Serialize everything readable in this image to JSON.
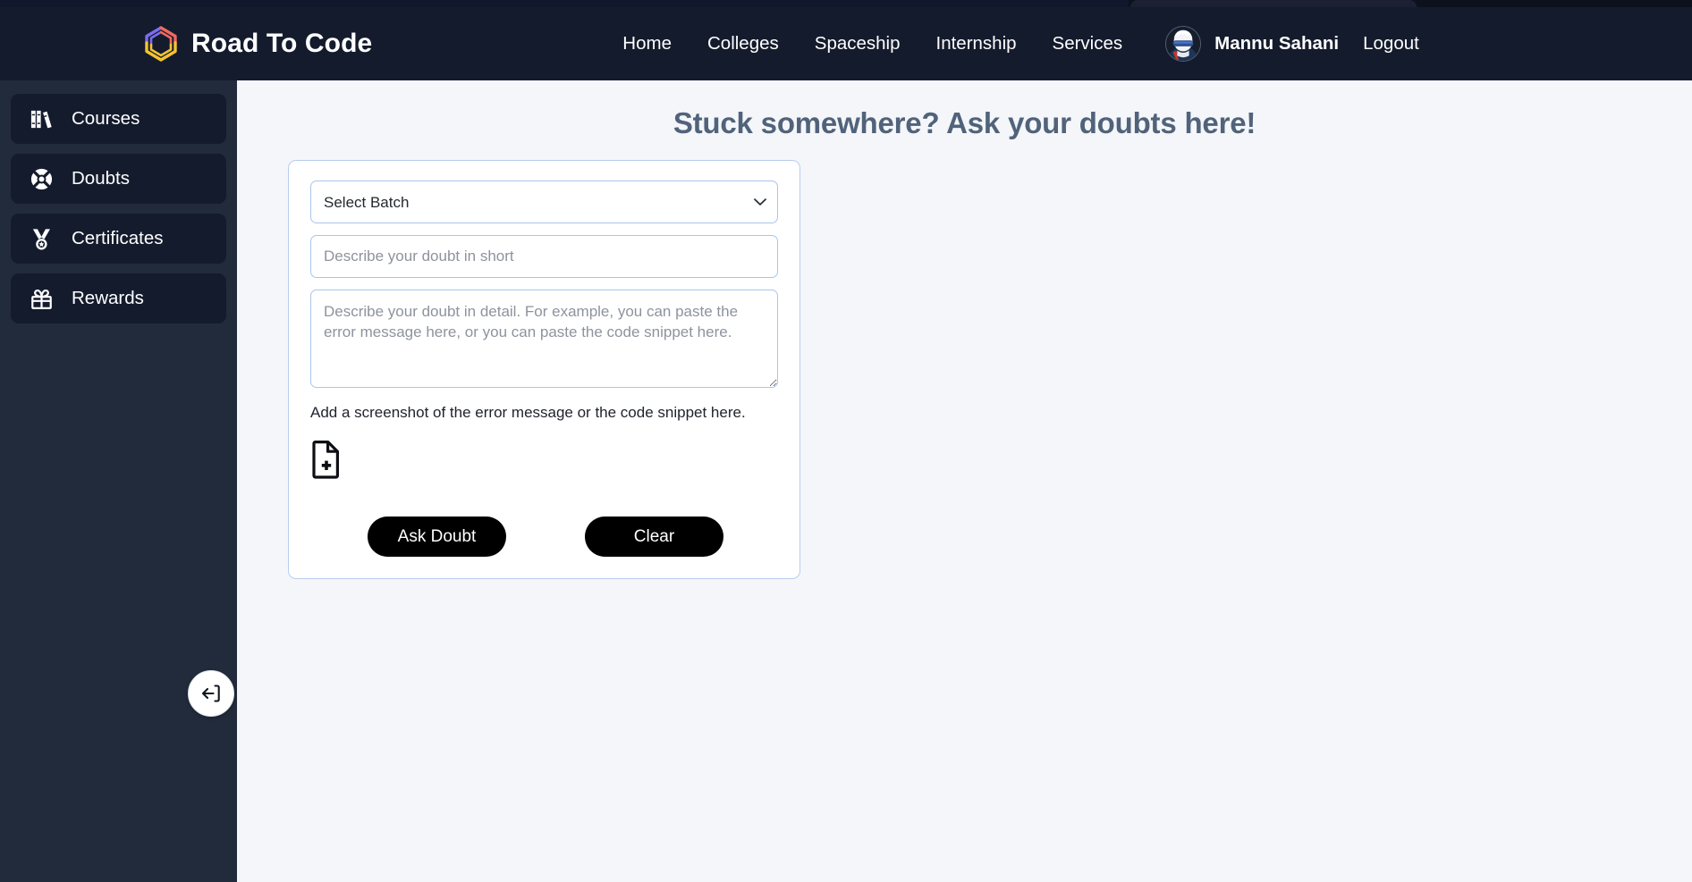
{
  "colors": {
    "header_bg": "#141b2d",
    "sidebar_bg": "#222b3c",
    "sidebar_item_bg": "#141b2d",
    "page_bg": "#f4f6fa",
    "card_border": "#b8cdf0",
    "field_border": "#aac4ee",
    "title_color": "#51637a",
    "button_bg": "#000000",
    "logo_purple": "#7c6cf0",
    "logo_red": "#f0695f",
    "logo_yellow": "#f5c331"
  },
  "brand": {
    "name": "Road To Code",
    "logo_icon": "hexagon-logo-icon"
  },
  "nav": {
    "items": [
      {
        "label": "Home"
      },
      {
        "label": "Colleges"
      },
      {
        "label": "Spaceship"
      },
      {
        "label": "Internship"
      },
      {
        "label": "Services"
      }
    ]
  },
  "user": {
    "name": "Mannu Sahani",
    "avatar_icon": "user-avatar",
    "logout_label": "Logout"
  },
  "sidebar": {
    "items": [
      {
        "label": "Courses",
        "icon": "books-icon"
      },
      {
        "label": "Doubts",
        "icon": "lifebuoy-icon"
      },
      {
        "label": "Certificates",
        "icon": "medal-icon"
      },
      {
        "label": "Rewards",
        "icon": "gift-icon"
      }
    ],
    "collapse_icon": "collapse-sidebar-icon"
  },
  "main": {
    "title": "Stuck somewhere? Ask your doubts here!"
  },
  "form": {
    "batch_select": {
      "selected": "Select Batch",
      "options": [
        "Select Batch"
      ],
      "chevron_icon": "chevron-down-icon"
    },
    "short_description": {
      "value": "",
      "placeholder": "Describe your doubt in short"
    },
    "detail_description": {
      "value": "",
      "placeholder": "Describe your doubt in detail. For example, you can paste the error message here, or you can paste the code snippet here."
    },
    "upload_helper": "Add a screenshot of the error message or the code snippet here.",
    "upload_icon": "file-plus-icon",
    "submit_label": "Ask Doubt",
    "clear_label": "Clear"
  }
}
